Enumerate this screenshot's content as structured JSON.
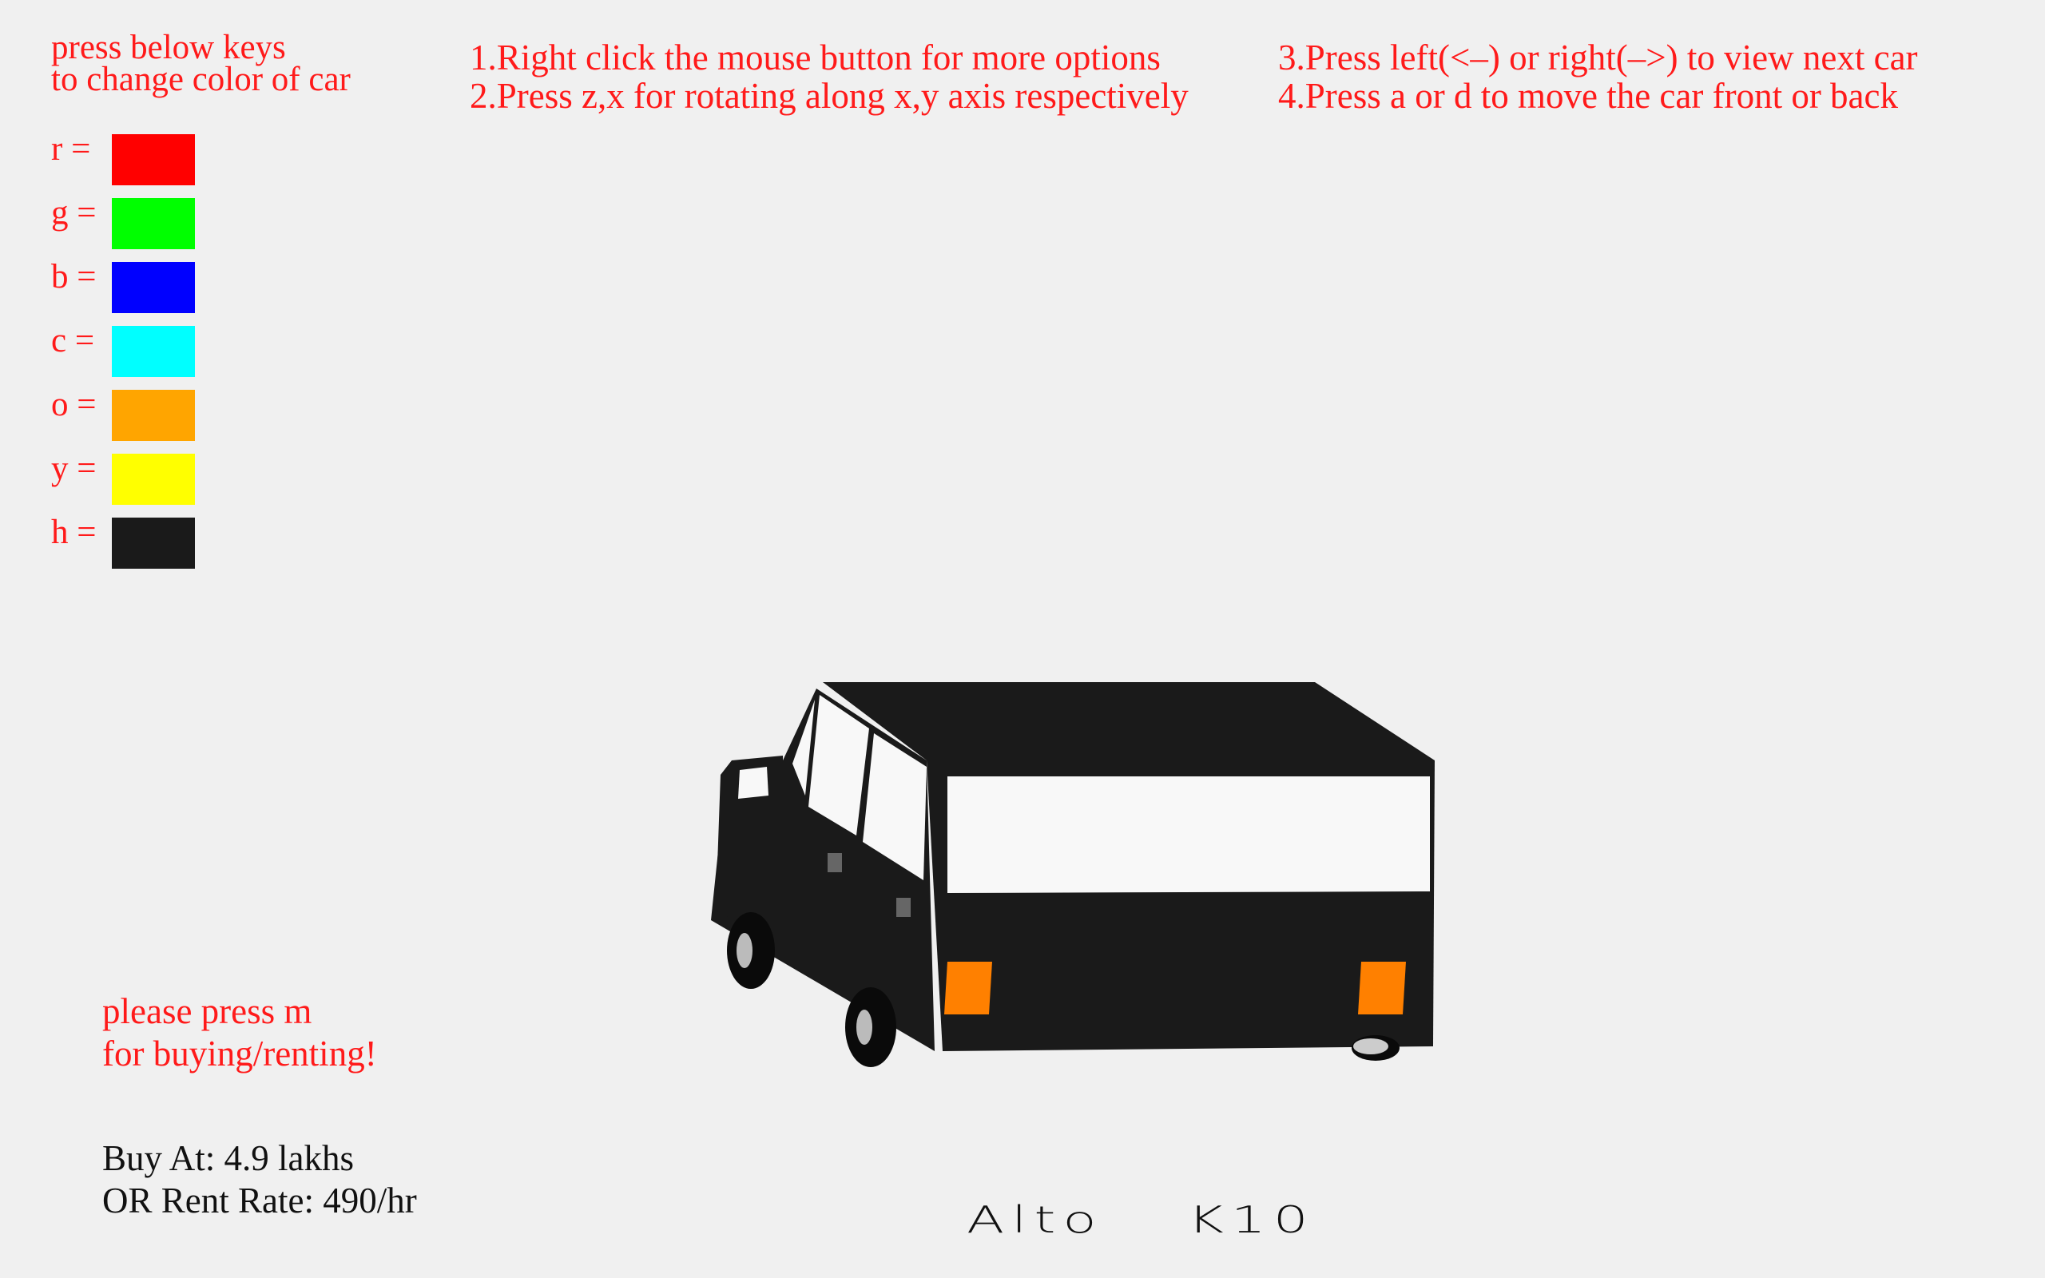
{
  "legend": {
    "line1": "press below keys",
    "line2": "to change color of car",
    "swatches": [
      {
        "label": "r =",
        "color": "#ff0000"
      },
      {
        "label": "g =",
        "color": "#00ff00"
      },
      {
        "label": "b =",
        "color": "#0000ff"
      },
      {
        "label": "c =",
        "color": "#00ffff"
      },
      {
        "label": "o =",
        "color": "#ffa500"
      },
      {
        "label": "y =",
        "color": "#ffff00"
      },
      {
        "label": "h =",
        "color": "#1a1a1a"
      }
    ]
  },
  "instructions": {
    "i1": "1.Right click the mouse button for more options",
    "i2": "2.Press z,x for rotating along x,y axis respectively",
    "i3": "3.Press left(<–) or right(–>) to view next car",
    "i4": "4.Press a or d to move the car front or back"
  },
  "prompt": {
    "line1": "please press m",
    "line2": "for buying/renting!"
  },
  "price": {
    "buy": "Buy At: 4.9 lakhs",
    "rent": "OR Rent Rate: 490/hr"
  },
  "car": {
    "name_part1": "Alto",
    "name_part2": "K10",
    "body_color": "#1a1a1a",
    "window_color": "#f8f8f8",
    "light_color": "#ff8000"
  },
  "colors": {
    "text_red": "#ff1a1a",
    "background": "#f0f0f0"
  }
}
